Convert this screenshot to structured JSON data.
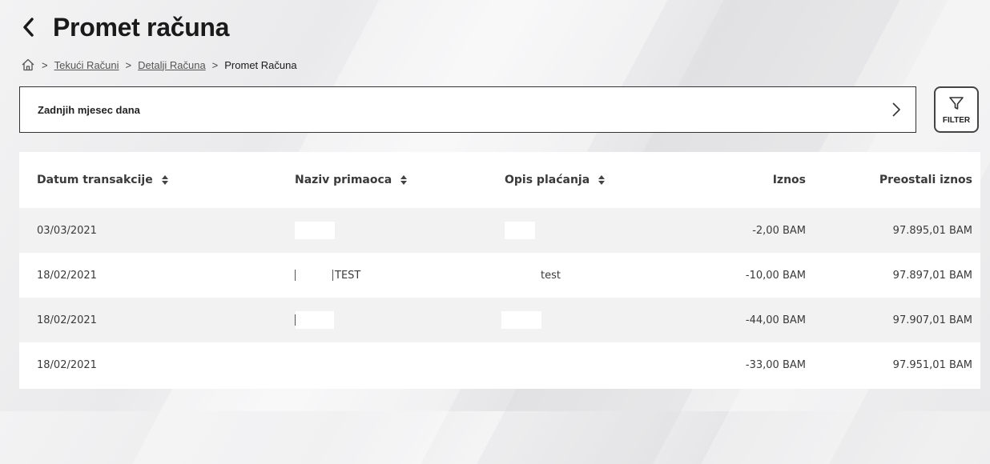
{
  "header": {
    "title": "Promet računa"
  },
  "breadcrumb": {
    "items": [
      {
        "label": "Tekući Računi"
      },
      {
        "label": "Detalji Računa"
      },
      {
        "label": "Promet Računa"
      }
    ]
  },
  "filter_bar": {
    "period": "Zadnjih mjesec dana",
    "filter_label": "FILTER"
  },
  "table": {
    "columns": [
      "Datum transakcije",
      "Naziv primaoca",
      "Opis plaćanja",
      "Iznos",
      "Preostali iznos"
    ],
    "rows": [
      {
        "date": "03/03/2021",
        "recipient": "",
        "description": "",
        "amount": "-2,00 BAM",
        "balance": "97.895,01 BAM"
      },
      {
        "date": "18/02/2021",
        "recipient": "TEST",
        "description": "test",
        "amount": "-10,00 BAM",
        "balance": "97.897,01 BAM"
      },
      {
        "date": "18/02/2021",
        "recipient": "",
        "description": "",
        "amount": "-44,00 BAM",
        "balance": "97.907,01 BAM"
      },
      {
        "date": "18/02/2021",
        "recipient": "",
        "description": "",
        "amount": "-33,00 BAM",
        "balance": "97.951,01 BAM"
      }
    ]
  },
  "colors": {
    "card": "#ffffff",
    "row_shade": "#f2f2f3",
    "text": "#3a3a3a"
  }
}
